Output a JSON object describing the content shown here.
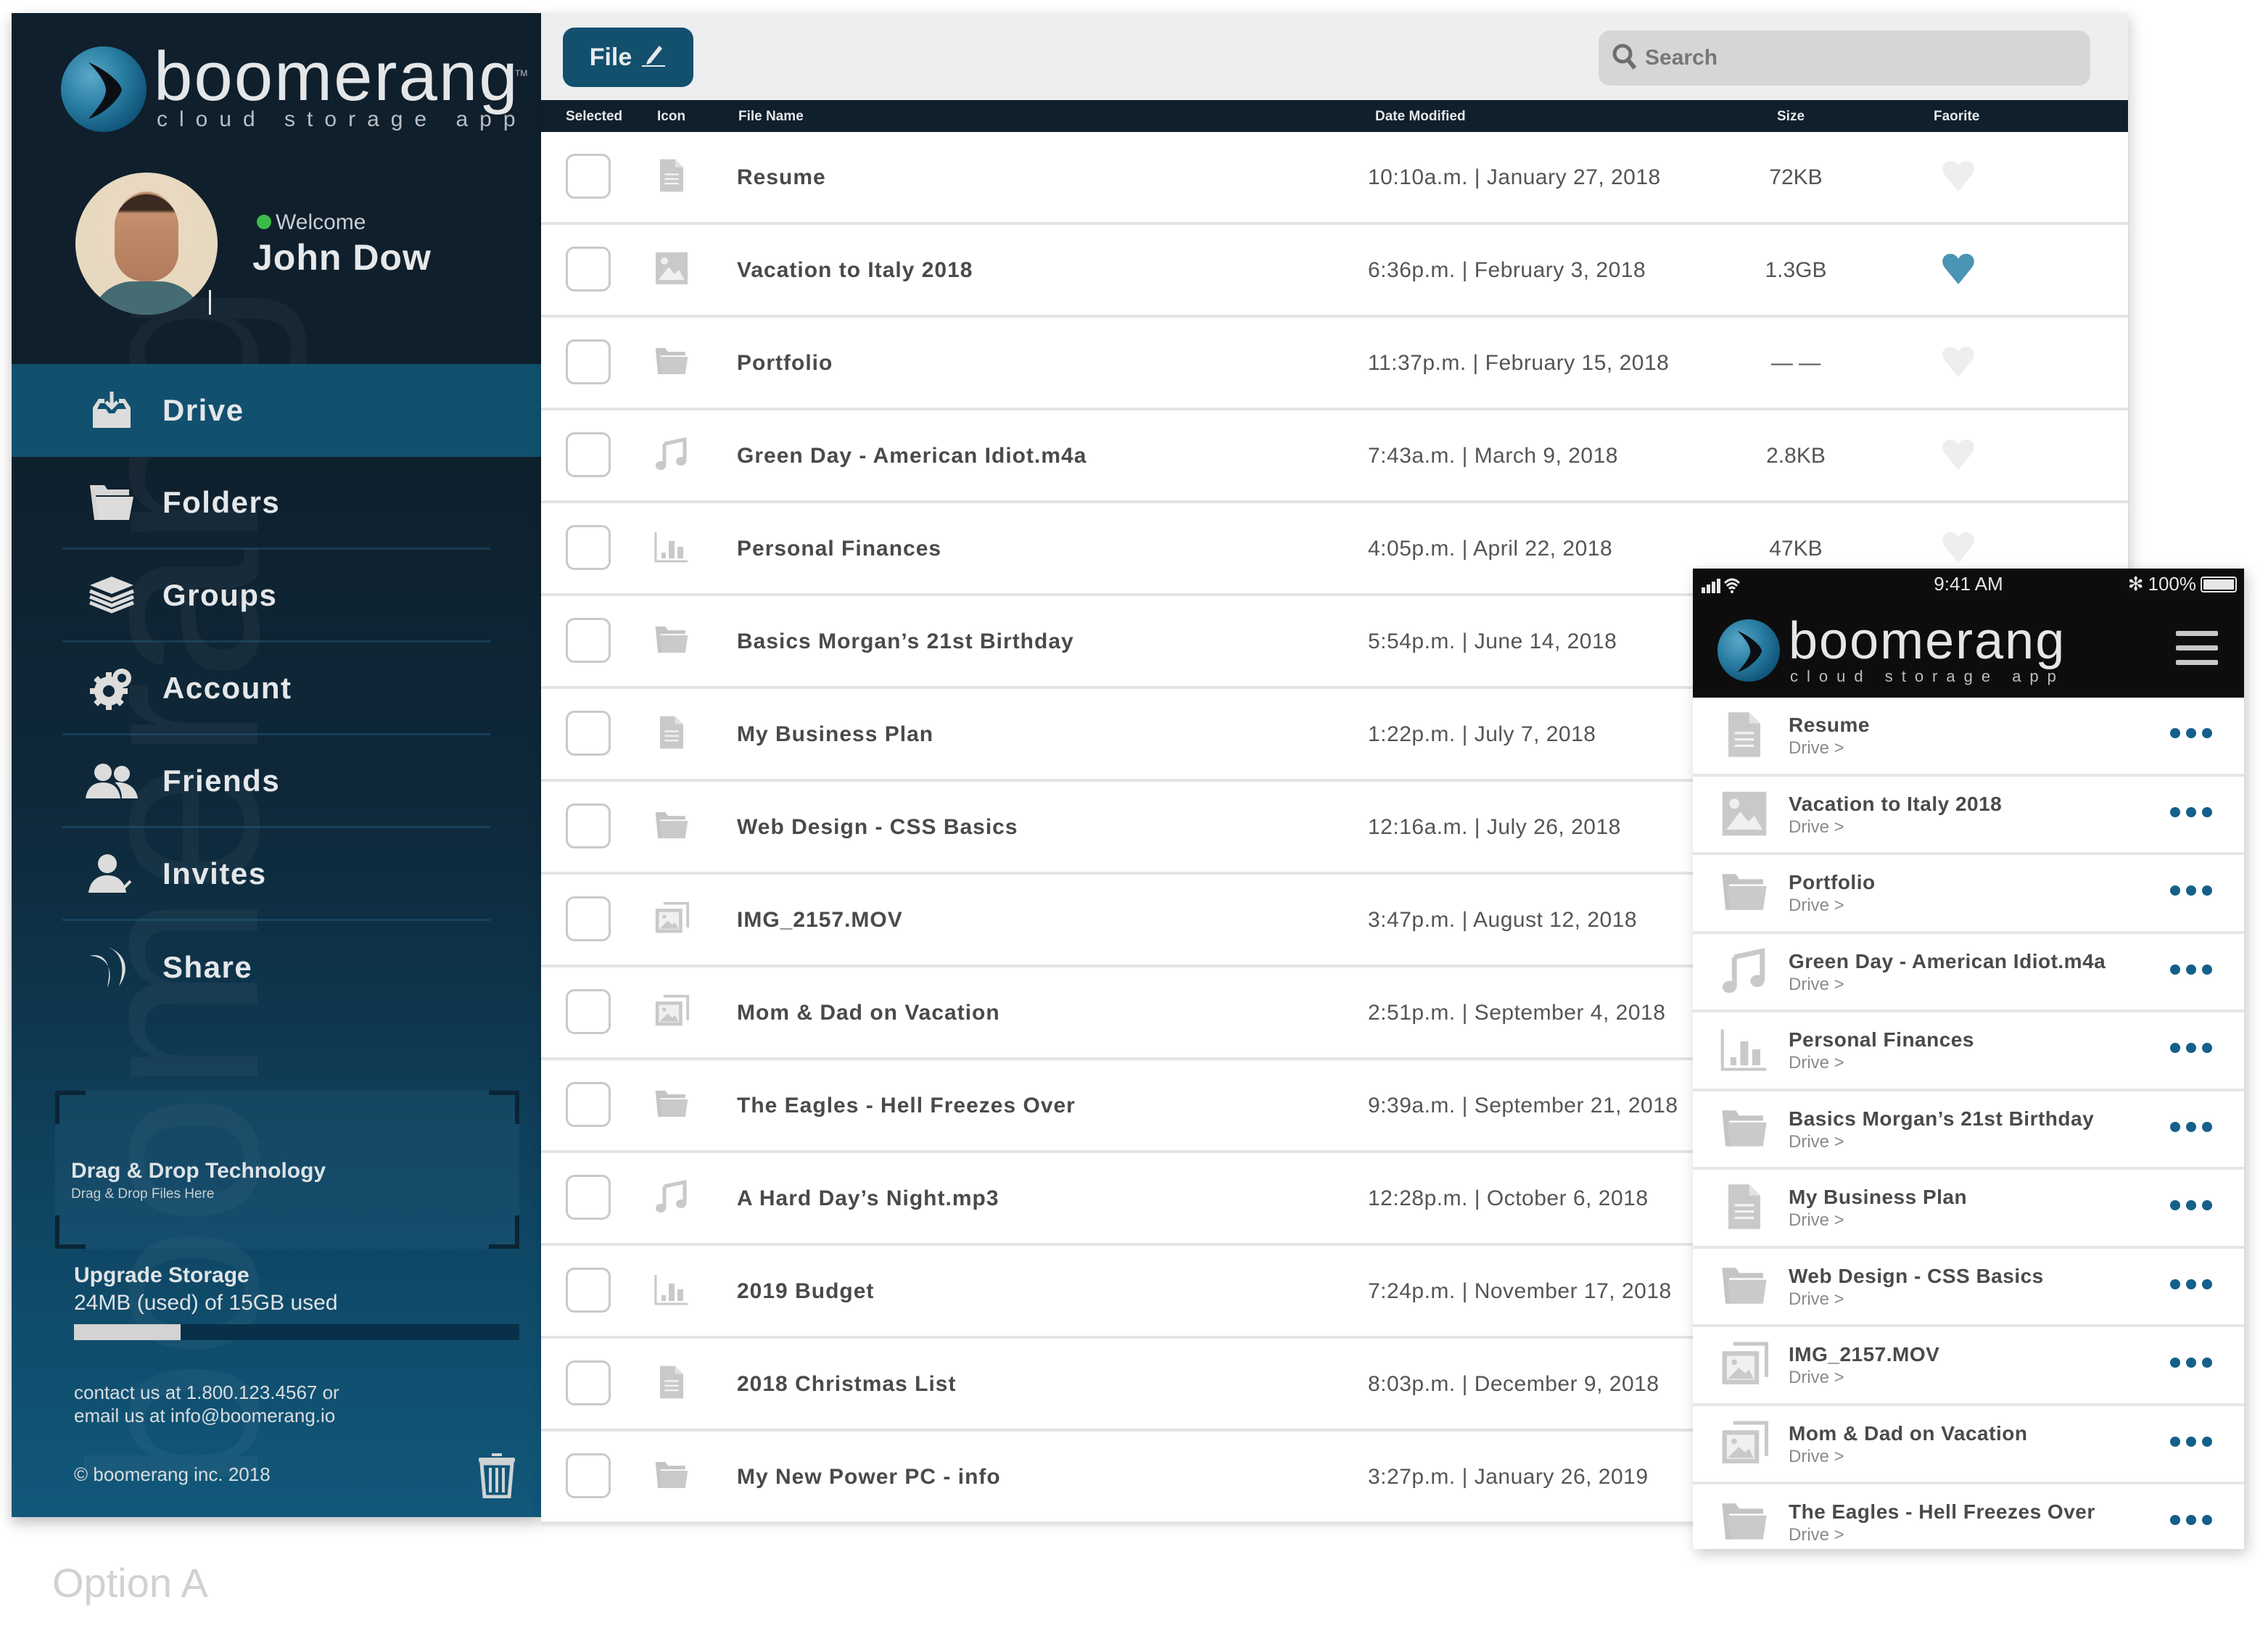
{
  "brand": {
    "name": "boomerang",
    "tagline": "cloud storage app",
    "trademark": "TM",
    "accent_color": "#13506e",
    "dark_color": "#0f1f2c",
    "favorite_color": "#4a94b4"
  },
  "user": {
    "greeting": "Welcome",
    "name": "John Dow",
    "status": "online"
  },
  "sidebar": {
    "items": [
      {
        "label": "Drive",
        "icon": "inbox-download-icon",
        "active": true
      },
      {
        "label": "Folders",
        "icon": "folder-open-icon",
        "active": false
      },
      {
        "label": "Groups",
        "icon": "layers-icon",
        "active": false
      },
      {
        "label": "Account",
        "icon": "gears-icon",
        "active": false
      },
      {
        "label": "Friends",
        "icon": "users-icon",
        "active": false
      },
      {
        "label": "Invites",
        "icon": "user-check-icon",
        "active": false
      },
      {
        "label": "Share",
        "icon": "share-arcs-icon",
        "active": false
      }
    ],
    "dropzone": {
      "title": "Drag & Drop Technology",
      "subtitle": "Drag & Drop Files Here"
    },
    "storage": {
      "title": "Upgrade Storage",
      "usage_text": "24MB (used) of 15GB used",
      "bar_fill_fraction": 0.24
    },
    "contact_line1": "contact us at 1.800.123.4567 or",
    "contact_line2": "email us at info@boomerang.io",
    "copyright": "© boomerang inc. 2018"
  },
  "toolbar": {
    "file_button_label": "File",
    "search_placeholder": "Search"
  },
  "table": {
    "columns": [
      "Selected",
      "Icon",
      "File Name",
      "Date Modified",
      "Size",
      "Faorite"
    ],
    "rows": [
      {
        "type": "document",
        "name": "Resume",
        "date": "10:10a.m. | January  27, 2018",
        "size": "72KB",
        "favorite": false
      },
      {
        "type": "image",
        "name": "Vacation to Italy 2018",
        "date": "6:36p.m. | February 3, 2018",
        "size": "1.3GB",
        "favorite": true
      },
      {
        "type": "folder",
        "name": "Portfolio",
        "date": "11:37p.m. | February 15, 2018",
        "size": "— —",
        "favorite": false
      },
      {
        "type": "music",
        "name": "Green Day - American Idiot.m4a",
        "date": "7:43a.m. | March  9, 2018",
        "size": "2.8KB",
        "favorite": false
      },
      {
        "type": "chart",
        "name": "Personal Finances",
        "date": "4:05p.m. | April  22, 2018",
        "size": "47KB",
        "favorite": false
      },
      {
        "type": "folder",
        "name": "Basics Morgan’s 21st Birthday",
        "date": "5:54p.m. | June 14, 2018",
        "size": "",
        "favorite": false
      },
      {
        "type": "document",
        "name": "My Business Plan",
        "date": "1:22p.m. | July 7, 2018",
        "size": "",
        "favorite": false
      },
      {
        "type": "folder",
        "name": "Web Design - CSS Basics",
        "date": "12:16a.m. | July 26, 2018",
        "size": "",
        "favorite": false
      },
      {
        "type": "gallery",
        "name": "IMG_2157.MOV",
        "date": "3:47p.m. | August 12, 2018",
        "size": "",
        "favorite": false
      },
      {
        "type": "gallery",
        "name": "Mom & Dad on Vacation",
        "date": "2:51p.m. | September 4, 2018",
        "size": "",
        "favorite": false
      },
      {
        "type": "folder",
        "name": "The Eagles - Hell Freezes Over",
        "date": "9:39a.m. | September 21, 2018",
        "size": "",
        "favorite": false
      },
      {
        "type": "music",
        "name": "A Hard Day’s Night.mp3",
        "date": "12:28p.m. | October 6, 2018",
        "size": "",
        "favorite": false
      },
      {
        "type": "chart",
        "name": "2019 Budget",
        "date": "7:24p.m. | November 17, 2018",
        "size": "",
        "favorite": false
      },
      {
        "type": "document",
        "name": "2018 Christmas List",
        "date": "8:03p.m. | December 9, 2018",
        "size": "",
        "favorite": false
      },
      {
        "type": "folder",
        "name": "My New Power PC - info",
        "date": "3:27p.m. | January 26, 2019",
        "size": "",
        "favorite": false
      }
    ]
  },
  "mobile": {
    "status_time": "9:41 AM",
    "battery": "100%",
    "menu_icon": "hamburger-menu-icon",
    "items": [
      {
        "type": "document",
        "name": "Resume",
        "location": "Drive >"
      },
      {
        "type": "image",
        "name": "Vacation to Italy 2018",
        "location": "Drive >"
      },
      {
        "type": "folder",
        "name": "Portfolio",
        "location": "Drive >"
      },
      {
        "type": "music",
        "name": "Green Day - American Idiot.m4a",
        "location": "Drive >"
      },
      {
        "type": "chart",
        "name": "Personal Finances",
        "location": "Drive >"
      },
      {
        "type": "folder",
        "name": "Basics Morgan’s 21st Birthday",
        "location": "Drive >"
      },
      {
        "type": "document",
        "name": "My Business Plan",
        "location": "Drive >"
      },
      {
        "type": "folder",
        "name": "Web Design - CSS Basics",
        "location": "Drive >"
      },
      {
        "type": "gallery",
        "name": "IMG_2157.MOV",
        "location": "Drive >"
      },
      {
        "type": "gallery",
        "name": "Mom & Dad on Vacation",
        "location": "Drive >"
      },
      {
        "type": "folder",
        "name": "The Eagles - Hell Freezes Over",
        "location": "Drive >"
      }
    ]
  },
  "caption": "Option A"
}
